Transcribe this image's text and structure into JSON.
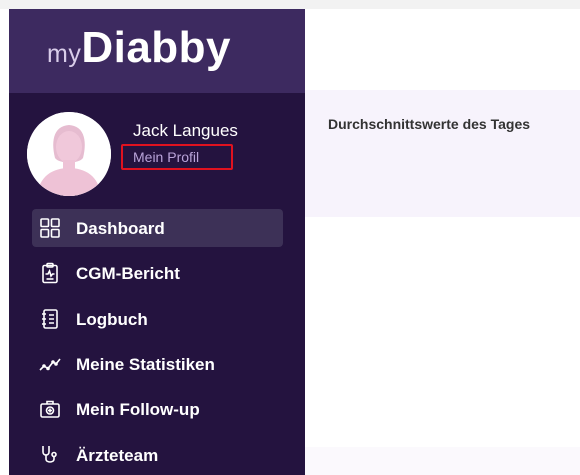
{
  "logo": {
    "prefix": "my",
    "name": "Diabby"
  },
  "user": {
    "name": "Jack Langues",
    "profile_link": "Mein Profil"
  },
  "nav": [
    {
      "label": "Dashboard",
      "icon": "dashboard-grid-icon",
      "active": true
    },
    {
      "label": "CGM-Bericht",
      "icon": "clipboard-report-icon",
      "active": false
    },
    {
      "label": "Logbuch",
      "icon": "notebook-icon",
      "active": false
    },
    {
      "label": "Meine Statistiken",
      "icon": "line-chart-icon",
      "active": false
    },
    {
      "label": "Mein Follow-up",
      "icon": "medical-case-icon",
      "active": false
    },
    {
      "label": "Ärzteteam",
      "icon": "stethoscope-icon",
      "active": false
    }
  ],
  "main": {
    "title": "Durchschnittswerte des Tages"
  },
  "colors": {
    "sidebar": "#24133f",
    "logo_area": "#3d2a60",
    "active_item": "#3d3157",
    "profile_link": "#b9a3d9",
    "highlight_border": "#e0121f",
    "panel": "#f7f3fc"
  }
}
